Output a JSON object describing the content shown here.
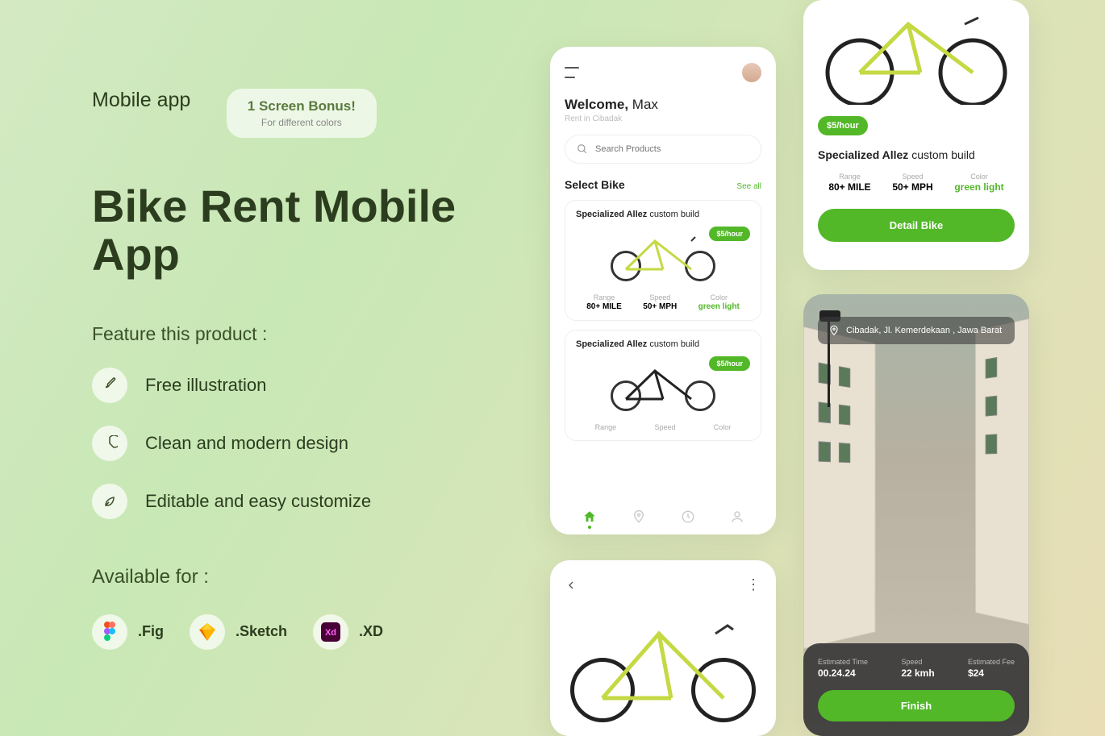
{
  "hero": {
    "subtitle": "Mobile app",
    "bonus_title": "1 Screen Bonus!",
    "bonus_sub": "For different colors",
    "title": "Bike Rent Mobile App",
    "features_heading": "Feature this product :",
    "features": [
      "Free illustration",
      "Clean and modern design",
      "Editable and easy customize"
    ],
    "available_heading": "Available for :",
    "formats": [
      ".Fig",
      ".Sketch",
      ".XD"
    ]
  },
  "home": {
    "welcome_bold": "Welcome,",
    "welcome_name": "Max",
    "location": "Rent in Cibadak",
    "search_placeholder": "Search Products",
    "section_title": "Select Bike",
    "see_all": "See all",
    "cards": [
      {
        "title_bold": "Specialized Allez",
        "title_rest": "custom build",
        "price": "$5/hour",
        "range_l": "Range",
        "range_v": "80+ MILE",
        "speed_l": "Speed",
        "speed_v": "50+ MPH",
        "color_l": "Color",
        "color_v": "green light"
      },
      {
        "title_bold": "Specialized Allez",
        "title_rest": "custom build",
        "price": "$5/hour",
        "range_l": "Range",
        "speed_l": "Speed",
        "color_l": "Color"
      }
    ]
  },
  "detail": {
    "price": "$5/hour",
    "title_bold": "Specialized Allez",
    "title_rest": "custom build",
    "range_l": "Range",
    "range_v": "80+ MILE",
    "speed_l": "Speed",
    "speed_v": "50+ MPH",
    "color_l": "Color",
    "color_v": "green light",
    "button": "Detail Bike"
  },
  "ride": {
    "address": "Cibadak, Jl. Kemerdekaan , Jawa Barat",
    "time_l": "Estimated Time",
    "time_v": "00.24.24",
    "speed_l": "Speed",
    "speed_v": "22 kmh",
    "fee_l": "Estimated Fee",
    "fee_v": "$24",
    "finish": "Finish"
  }
}
